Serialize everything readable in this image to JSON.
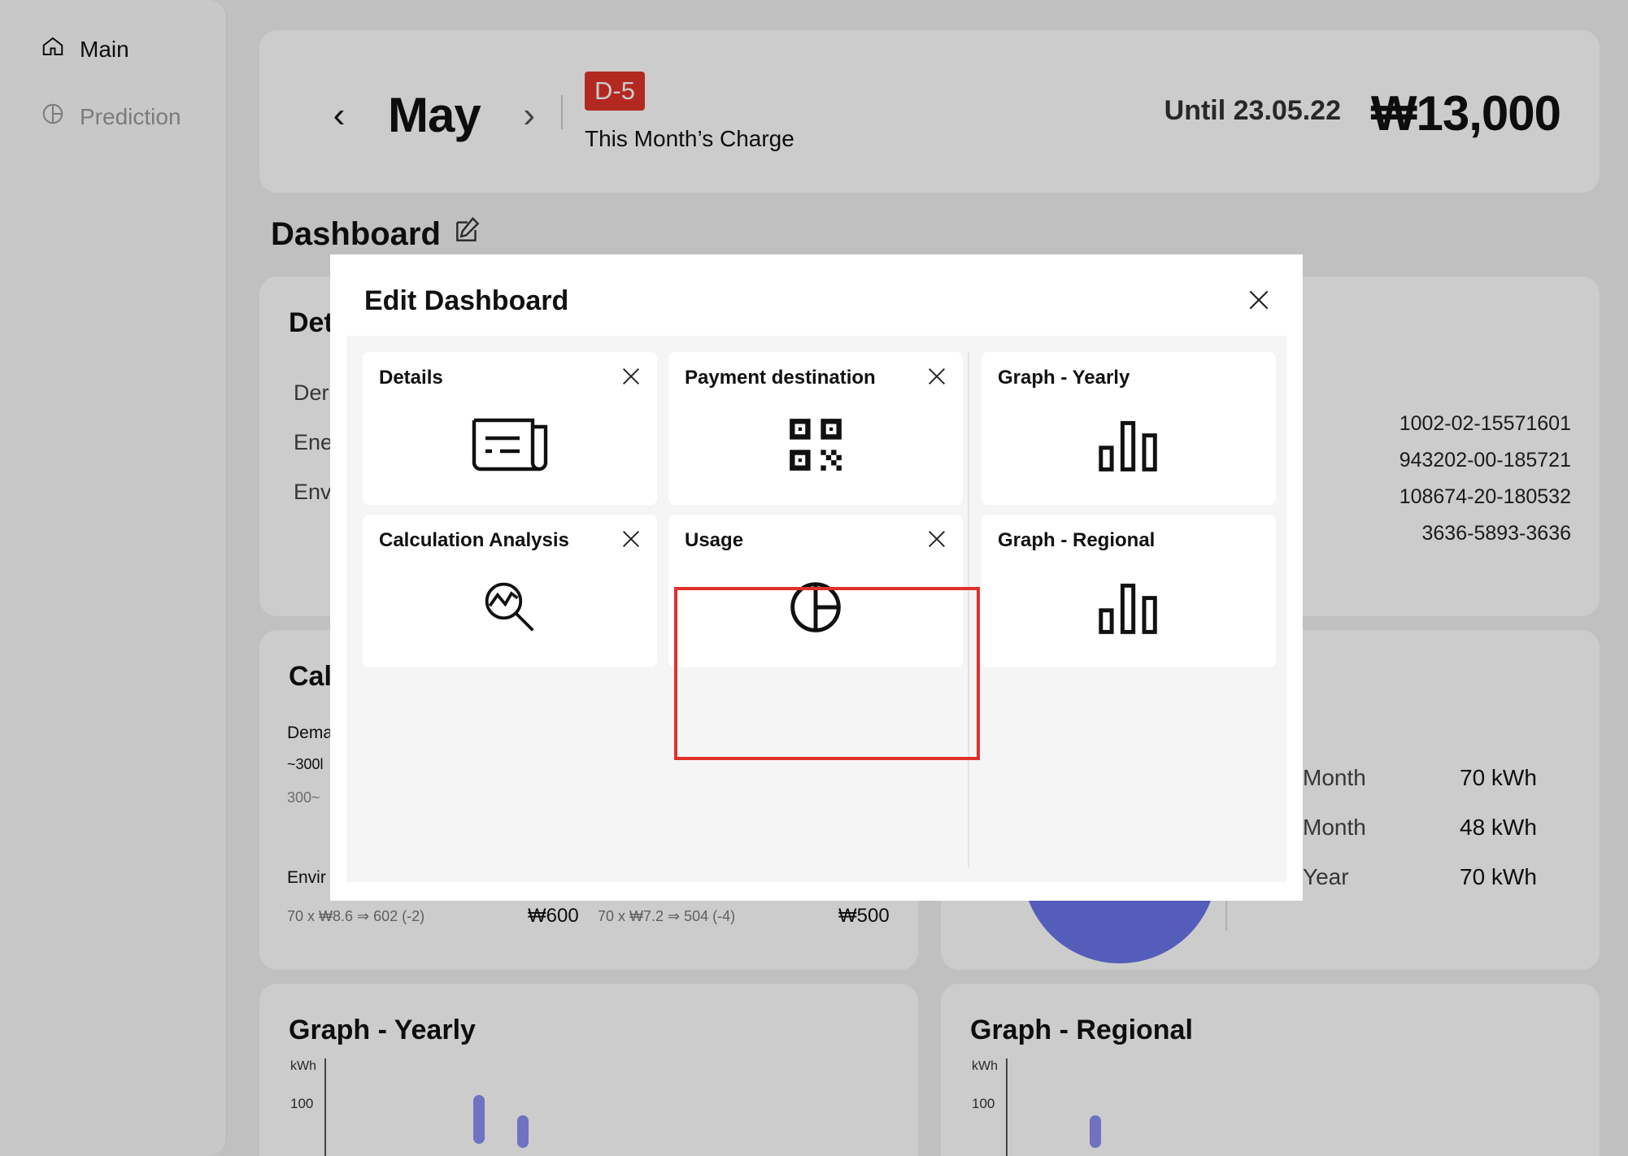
{
  "sidebar": {
    "items": [
      {
        "label": "Main",
        "icon": "home-icon"
      },
      {
        "label": "Prediction",
        "icon": "pie-chart-icon"
      }
    ]
  },
  "header": {
    "month": "May",
    "d_badge": "D-5",
    "charge_label": "This Month’s Charge",
    "until": "Until 23.05.22",
    "amount": "₩13,000"
  },
  "dashboard": {
    "title": "Dashboard",
    "bg_details_title_part": "Det",
    "bg_details_labels": [
      "Der",
      "Ene",
      "Env"
    ],
    "account_numbers": [
      "1002-02-15571601",
      "943202-00-185721",
      "108674-20-180532",
      "3636-5893-3636"
    ],
    "bg_calc_title_part": "Cal",
    "bg_calc_labels": [
      "Dema",
      "~300l",
      "300~",
      "Envir"
    ],
    "calc_rows": {
      "left_formula": "70 x ₩8.6 ⇒ 602 (-2)",
      "left_amount": "₩600",
      "right_formula": "70 x ₩7.2 ⇒ 504 (-4)",
      "right_amount": "₩500"
    },
    "usage_rows": [
      {
        "label": "Month",
        "value": "70 kWh"
      },
      {
        "label": "Month",
        "value": "48 kWh"
      },
      {
        "label": "Year",
        "value": "70 kWh"
      }
    ],
    "graph_yearly": {
      "title": "Graph - Yearly",
      "unit": "kWh",
      "tick": "100"
    },
    "graph_regional": {
      "title": "Graph - Regional",
      "unit": "kWh",
      "tick": "100"
    }
  },
  "modal": {
    "title": "Edit Dashboard",
    "widgets": [
      {
        "title": "Details",
        "icon": "receipt-icon",
        "removable": true
      },
      {
        "title": "Payment destination",
        "icon": "qr-code-icon",
        "removable": true
      },
      {
        "title": "Graph - Yearly",
        "icon": "bar-chart-icon",
        "removable": false
      },
      {
        "title": "Calculation Analysis",
        "icon": "magnifier-chart-icon",
        "removable": true
      },
      {
        "title": "Usage",
        "icon": "pie-chart-icon",
        "removable": true,
        "highlighted": true
      },
      {
        "title": "Graph - Regional",
        "icon": "bar-chart-icon",
        "removable": false
      }
    ]
  },
  "colors": {
    "accent_red": "#e0342a",
    "chart_purple": "#6a75e8"
  }
}
